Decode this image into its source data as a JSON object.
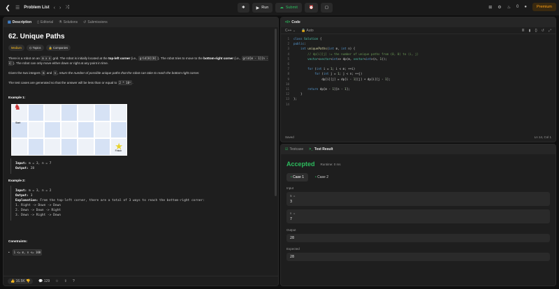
{
  "topbar": {
    "title": "Problem List",
    "run_label": "Run",
    "submit_label": "Submit",
    "fire_count": "0",
    "premium_label": "Premium"
  },
  "left_tabs": [
    {
      "label": "Description"
    },
    {
      "label": "Editorial"
    },
    {
      "label": "Solutions"
    },
    {
      "label": "Submissions"
    }
  ],
  "problem": {
    "title": "62. Unique Paths",
    "difficulty": "Medium",
    "topics_label": "Topics",
    "companies_label": "Companies",
    "p1a": "There is a robot on an ",
    "p1_mn": "m x n",
    "p1b": " grid. The robot is initially located at the ",
    "p1_tl": "top-left corner",
    "p1c": " (i.e., ",
    "p1_g00": "grid[0][0]",
    "p1d": "). The robot tries to move to the ",
    "p1_br": "bottom-right corner",
    "p1e": " (i.e., ",
    "p1_gmn": "grid[m - 1][n - 1]",
    "p1f": "). The robot can only move either down or right at any point in time.",
    "p2a": "Given the two integers ",
    "p2_m": "m",
    "p2b": " and ",
    "p2_n": "n",
    "p2c": ", return the number of possible unique paths that the robot can take to reach the bottom-right corner.",
    "p3a": "The test cases are generated so that the answer will be less than or equal to ",
    "p3_code": "2 * 10⁹",
    "p3b": ".",
    "ex1_title": "Example 1:",
    "start_label": "Start",
    "finish_label": "Finish",
    "ex1_input_label": "Input:",
    "ex1_input": "m = 3, n = 7",
    "ex1_output_label": "Output:",
    "ex1_output": "28",
    "ex2_title": "Example 2:",
    "ex2_input_label": "Input:",
    "ex2_input": "m = 3, n = 2",
    "ex2_output_label": "Output:",
    "ex2_output": "3",
    "ex2_expl_label": "Explanation:",
    "ex2_expl": "From the top-left corner, there are a total of 3 ways to reach the bottom-right corner:",
    "ex2_l1": "1. Right -> Down -> Down",
    "ex2_l2": "2. Down -> Down -> Right",
    "ex2_l3": "3. Down -> Right -> Down",
    "constraints_title": "Constraints:",
    "constraint1": "1 <= m, n <= 100"
  },
  "left_bottom": {
    "likes": "16.5K",
    "comments": "129"
  },
  "code_panel": {
    "tab": "Code",
    "lang": "C++",
    "mode": "Auto",
    "status_left": "Saved",
    "status_right": "Ln 14, Col 1"
  },
  "test_panel": {
    "tab1": "Testcase",
    "tab2": "Test Result",
    "result": "Accepted",
    "runtime": "Runtime: 0 ms",
    "case1": "Case 1",
    "case2": "Case 2",
    "input_label": "Input",
    "m_key": "m =",
    "m_val": "3",
    "n_key": "n =",
    "n_val": "7",
    "output_label": "Output",
    "output_val": "28",
    "expected_label": "Expected",
    "expected_val": "28"
  },
  "colors": {
    "accent_green": "#2cbb5d",
    "medium": "#ffc01e",
    "premium": "#ffa116"
  }
}
